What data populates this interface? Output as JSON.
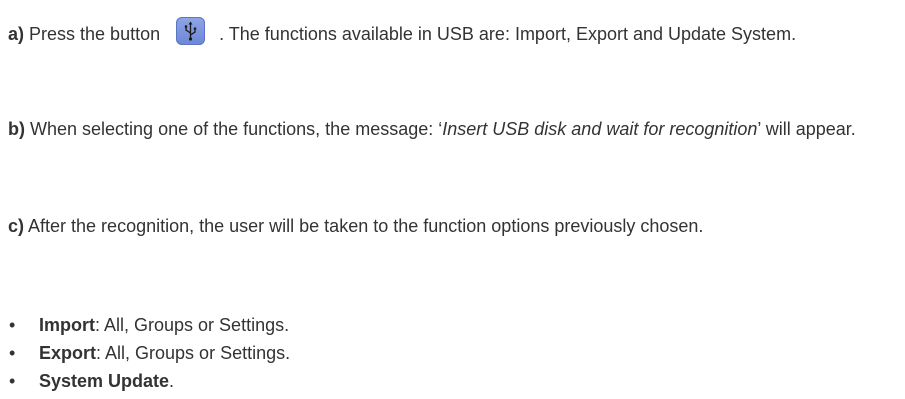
{
  "paragraphs": {
    "a": {
      "marker": "a)",
      "text_before": " Press the button",
      "text_after": ". The functions available in USB are: Import, Export and Update System.",
      "button_icon": "usb-icon"
    },
    "b": {
      "marker": "b)",
      "text_before": " When selecting one of the functions, the message:  ‘",
      "italic": "Insert USB disk and wait for recognition",
      "text_after": "’ will appear."
    },
    "c": {
      "marker": "c)",
      "text": " After the recognition, the user will be taken to the function options previously chosen."
    }
  },
  "list": {
    "bullet": "•",
    "items": [
      {
        "bold": "Import",
        "text": ": All, Groups or Settings."
      },
      {
        "bold": "Export",
        "text": ": All, Groups or Settings."
      },
      {
        "bold": "System Update",
        "text": "."
      }
    ]
  },
  "colors": {
    "text": "#333333",
    "button": "#7f97e0"
  }
}
